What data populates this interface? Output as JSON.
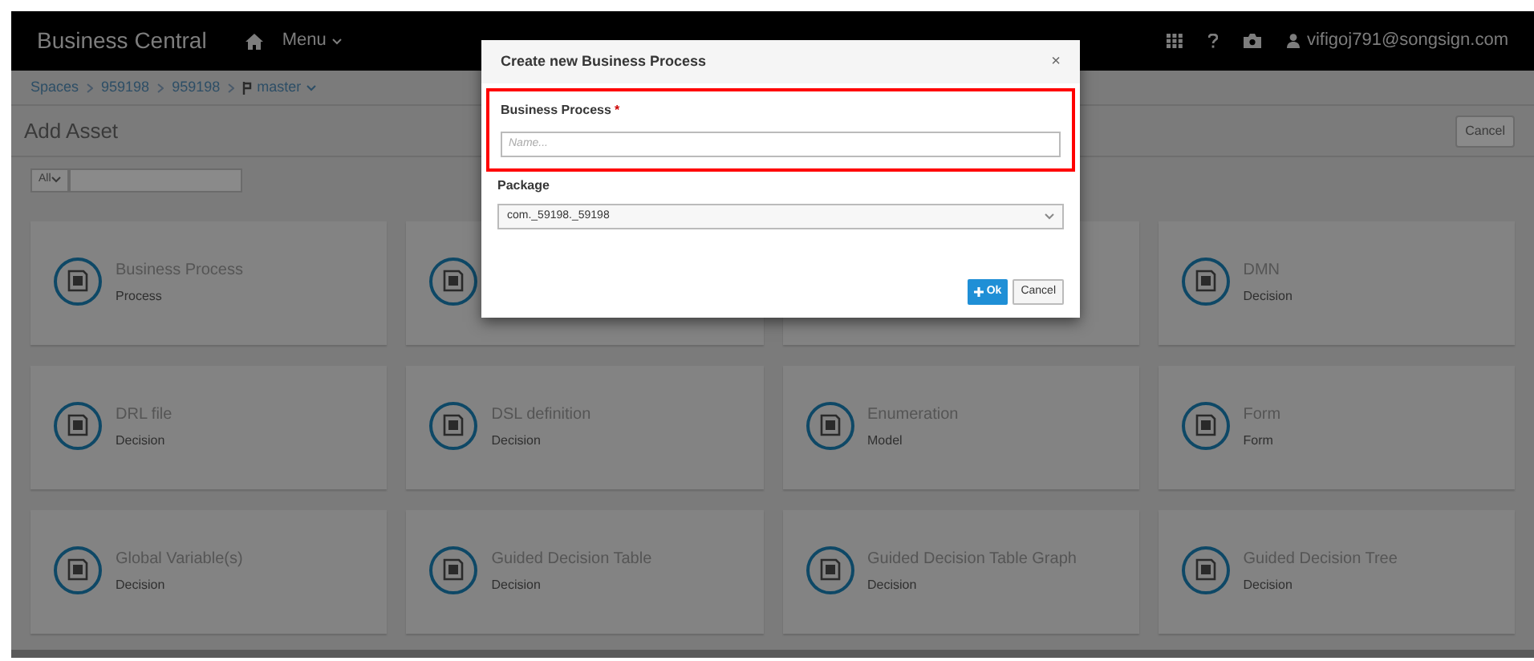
{
  "header": {
    "brand": "Business Central",
    "menu": "Menu",
    "user": "vifigoj791@songsign.com"
  },
  "breadcrumbs": [
    "Spaces",
    "959198",
    "959198",
    "master"
  ],
  "page": {
    "title": "Add Asset",
    "cancel": "Cancel",
    "filter": "All"
  },
  "cards": [
    {
      "kind": "full",
      "title": "Business Process",
      "subtitle": "Process"
    },
    {
      "kind": "icon_only"
    },
    {
      "kind": "covered"
    },
    {
      "kind": "full",
      "title": "DMN",
      "subtitle": "Decision"
    },
    {
      "kind": "full",
      "title": "DRL file",
      "subtitle": "Decision"
    },
    {
      "kind": "full",
      "title": "DSL definition",
      "subtitle": "Decision"
    },
    {
      "kind": "full",
      "title": "Enumeration",
      "subtitle": "Model"
    },
    {
      "kind": "full",
      "title": "Form",
      "subtitle": "Form"
    },
    {
      "kind": "full",
      "title": "Global Variable(s)",
      "subtitle": "Decision"
    },
    {
      "kind": "full",
      "title": "Guided Decision Table",
      "subtitle": "Decision"
    },
    {
      "kind": "full",
      "title": "Guided Decision Table Graph",
      "subtitle": "Decision"
    },
    {
      "kind": "full",
      "title": "Guided Decision Tree",
      "subtitle": "Decision"
    }
  ],
  "dialog": {
    "title": "Create new Business Process",
    "close": "×",
    "name_label": "Business Process",
    "required": "*",
    "name_placeholder": "Name...",
    "name_highlighted": true,
    "package_label": "Package",
    "package_value": "com._59198._59198",
    "ok": "Ok",
    "cancel": "Cancel"
  }
}
